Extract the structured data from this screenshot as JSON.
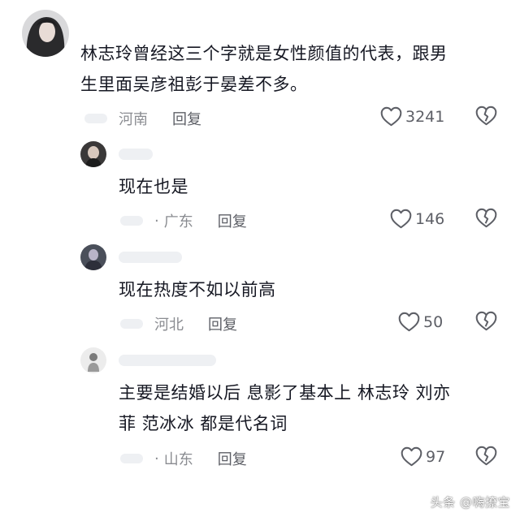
{
  "comments": [
    {
      "text_line1": "林志玲曾经这三个字就是女性颜值的代表，跟男",
      "text_line2": "生里面吴彦祖彭于晏差不多。",
      "location": "河南",
      "reply_label": "回复",
      "likes": "3241",
      "heart_icon": "heart-outline-icon",
      "dislike_icon": "broken-heart-icon"
    },
    {
      "text_line1": "现在也是",
      "location": "广东",
      "reply_label": "回复",
      "likes": "146"
    },
    {
      "text_line1": "现在热度不如以前高",
      "location": "河北",
      "reply_label": "回复",
      "likes": "50"
    },
    {
      "text_line1": "主要是结婚以后 息影了基本上 林志玲 刘亦",
      "text_line2": "菲 范冰冰 都是代名词",
      "location": "山东",
      "reply_label": "回复",
      "likes": "97"
    }
  ],
  "watermark": "头条 @嗨撩宝",
  "colors": {
    "text": "#161823",
    "meta": "#8a8c91",
    "icon": "#5d5f66"
  }
}
